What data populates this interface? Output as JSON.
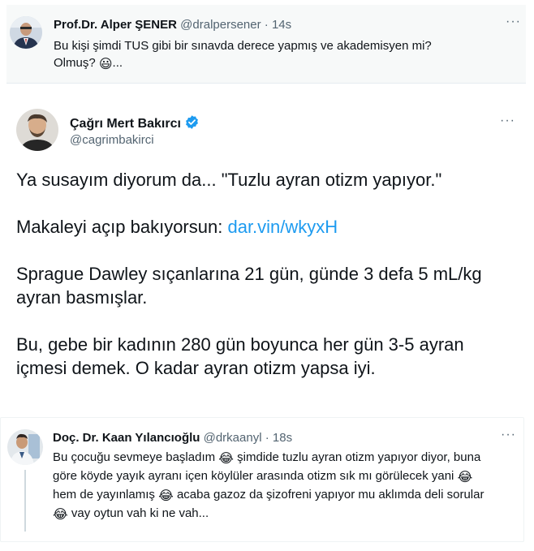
{
  "quoted_top": {
    "name": "Prof.Dr. Alper ŞENER",
    "handle": "@dralpersener",
    "separator": "·",
    "time": "14s",
    "text_line1": "Bu kişi şimdi TUS gibi bir sınavda derece yapmış ve akademisyen mi?",
    "text_line2_prefix": "Olmuş?",
    "emoji": "😃",
    "text_line2_suffix": "...",
    "more_icon": "···"
  },
  "main_tweet": {
    "name": "Çağrı Mert Bakırcı",
    "handle": "@cagrimbakirci",
    "verified_color": "#1d9bf0",
    "more_icon": "···",
    "para1": "Ya susayım diyorum da... \"Tuzlu ayran otizm yapıyor.\"",
    "para2_prefix": "Makaleyi açıp bakıyorsun: ",
    "para2_link": "dar.vin/wkyxH",
    "para3": "Sprague Dawley sıçanlarına 21 gün, günde 3 defa 5 mL/kg ayran basmışlar.",
    "para4": "Bu, gebe bir kadının 280 gün boyunca her gün 3-5 ayran içmesi demek. O kadar ayran otizm yapsa iyi."
  },
  "reply": {
    "name": "Doç. Dr. Kaan Yılancıoğlu",
    "handle": "@drkaanyl",
    "separator": "·",
    "time": "18s",
    "more_icon": "···",
    "seg1": "Bu çocuğu sevmeye başladım",
    "seg2": "şimdide tuzlu ayran otizm yapıyor diyor, buna göre köyde yayık ayranı içen köylüler arasında otizm sık mı görülecek yani",
    "seg3": "hem de yayınlamış",
    "seg4": "acaba gazoz da şizofreni yapıyor mu aklımda deli sorular",
    "seg5": "vay oytun vah ki ne vah...",
    "emoji": "😂"
  }
}
